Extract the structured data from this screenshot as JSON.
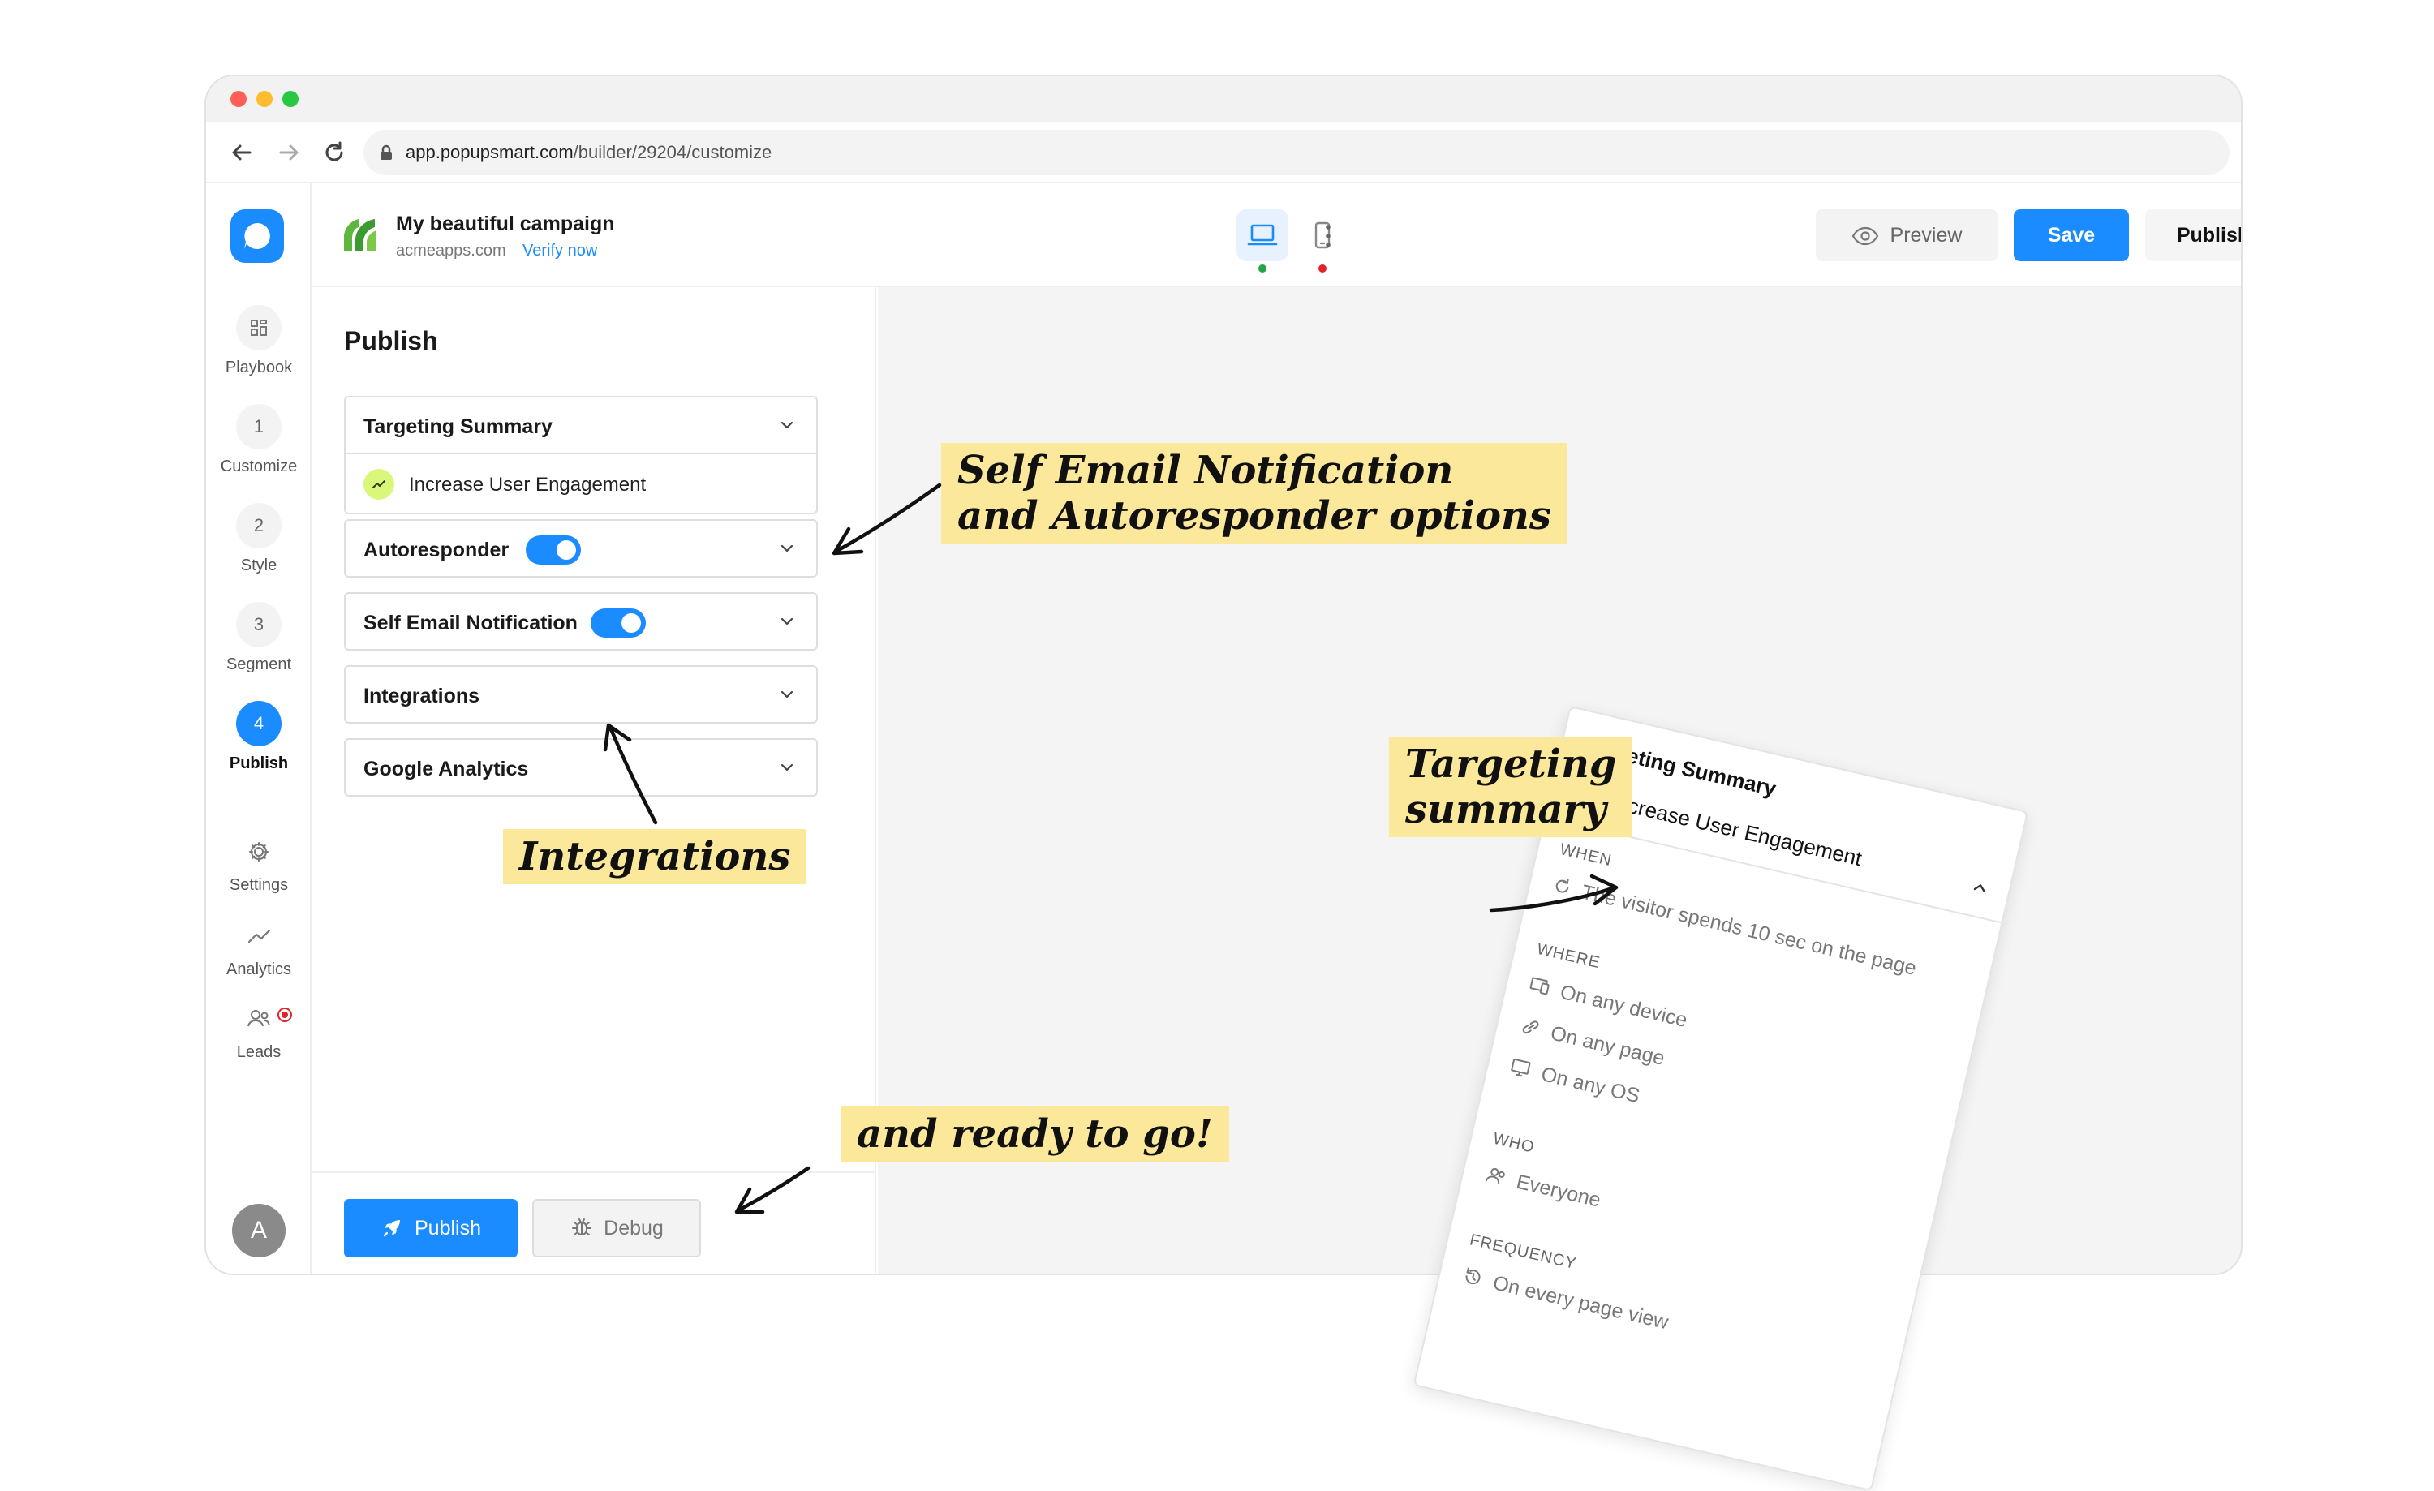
{
  "browser": {
    "url_host": "app.popupsmart.com",
    "url_path": "/builder/29204/customize"
  },
  "campaign": {
    "title": "My beautiful campaign",
    "domain": "acmeapps.com",
    "verify_label": "Verify now"
  },
  "topbar": {
    "preview_label": "Preview",
    "save_label": "Save",
    "publish_label": "Publish"
  },
  "rail": {
    "items": [
      {
        "label": "Playbook"
      },
      {
        "step": "1",
        "label": "Customize"
      },
      {
        "step": "2",
        "label": "Style"
      },
      {
        "step": "3",
        "label": "Segment"
      },
      {
        "step": "4",
        "label": "Publish"
      }
    ],
    "settings_label": "Settings",
    "analytics_label": "Analytics",
    "leads_label": "Leads",
    "avatar_letter": "A"
  },
  "panel": {
    "title": "Publish",
    "accordions": [
      {
        "label": "Targeting Summary",
        "body": "Increase User Engagement"
      },
      {
        "label": "Autoresponder",
        "enabled": true
      },
      {
        "label": "Self Email Notification",
        "enabled": true
      },
      {
        "label": "Integrations"
      },
      {
        "label": "Google Analytics"
      }
    ],
    "publish_button": "Publish",
    "debug_button": "Debug"
  },
  "summary_card": {
    "title": "Targeting Summary",
    "goal": "Increase User Engagement",
    "sections": {
      "when": "WHEN",
      "where": "WHERE",
      "who": "WHO",
      "frequency": "FREQUENCY"
    },
    "when_text": "The visitor spends 10 sec on the page",
    "where_items": [
      "On any device",
      "On any page",
      "On any OS"
    ],
    "who_text": "Everyone",
    "frequency_text": "On every page view"
  },
  "annotations": {
    "self_email": [
      "Self Email Notification",
      "and Autoresponder options"
    ],
    "integrations": "Integrations",
    "targeting": [
      "Targeting",
      "summary"
    ],
    "ready": "and ready to go!"
  },
  "colors": {
    "accent": "#1a8cff",
    "note_bg": "#fbe89b",
    "badge_green": "#d9f77a",
    "status_green": "#22a447",
    "status_red": "#e0242b"
  }
}
